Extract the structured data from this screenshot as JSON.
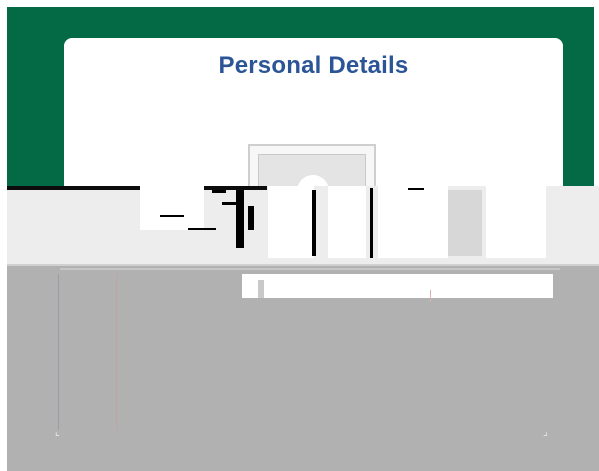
{
  "card": {
    "title": "Personal Details"
  },
  "avatar": {
    "icon": "user-photo-placeholder-icon"
  },
  "colors": {
    "header_green": "#046a46",
    "title_blue": "#2b5597",
    "overlay_gray": "#b1b1b1"
  }
}
